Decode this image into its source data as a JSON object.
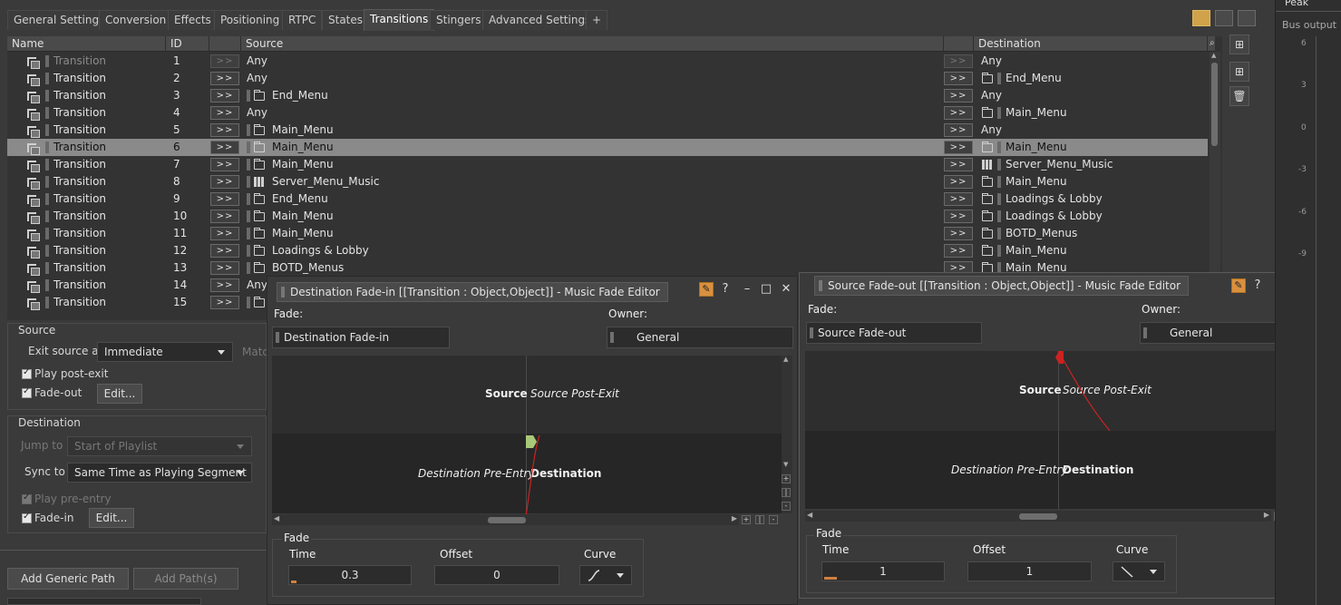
{
  "tabs": {
    "items": [
      "General Settings",
      "Conversion",
      "Effects",
      "Positioning",
      "RTPC",
      "States",
      "Transitions",
      "Stingers",
      "Advanced Settings",
      "+"
    ],
    "active": "Transitions"
  },
  "grid": {
    "headers": {
      "name": "Name",
      "id": "ID",
      "source": "Source",
      "destination": "Destination"
    },
    "arrow_label": ">>",
    "rows": [
      {
        "name": "Transition",
        "id": "1",
        "source": "Any",
        "source_icon": "none",
        "dest": "Any",
        "dest_icon": "none",
        "dim": true
      },
      {
        "name": "Transition",
        "id": "2",
        "source": "Any",
        "source_icon": "none",
        "dest": "End_Menu",
        "dest_icon": "folder"
      },
      {
        "name": "Transition",
        "id": "3",
        "source": "End_Menu",
        "source_icon": "folder",
        "dest": "Any",
        "dest_icon": "none"
      },
      {
        "name": "Transition",
        "id": "4",
        "source": "Any",
        "source_icon": "none",
        "dest": "Main_Menu",
        "dest_icon": "folder"
      },
      {
        "name": "Transition",
        "id": "5",
        "source": "Main_Menu",
        "source_icon": "folder",
        "dest": "Any",
        "dest_icon": "none"
      },
      {
        "name": "Transition",
        "id": "6",
        "source": "Main_Menu",
        "source_icon": "folder",
        "dest": "Main_Menu",
        "dest_icon": "folder",
        "selected": true
      },
      {
        "name": "Transition",
        "id": "7",
        "source": "Main_Menu",
        "source_icon": "folder",
        "dest": "Server_Menu_Music",
        "dest_icon": "grid"
      },
      {
        "name": "Transition",
        "id": "8",
        "source": "Server_Menu_Music",
        "source_icon": "grid",
        "dest": "Main_Menu",
        "dest_icon": "folder"
      },
      {
        "name": "Transition",
        "id": "9",
        "source": "End_Menu",
        "source_icon": "folder",
        "dest": "Loadings & Lobby",
        "dest_icon": "folder"
      },
      {
        "name": "Transition",
        "id": "10",
        "source": "Main_Menu",
        "source_icon": "folder",
        "dest": "Loadings & Lobby",
        "dest_icon": "folder"
      },
      {
        "name": "Transition",
        "id": "11",
        "source": "Main_Menu",
        "source_icon": "folder",
        "dest": "BOTD_Menus",
        "dest_icon": "folder"
      },
      {
        "name": "Transition",
        "id": "12",
        "source": "Loadings & Lobby",
        "source_icon": "folder",
        "dest": "Main_Menu",
        "dest_icon": "folder"
      },
      {
        "name": "Transition",
        "id": "13",
        "source": "BOTD_Menus",
        "source_icon": "folder",
        "dest": "Main_Menu",
        "dest_icon": "folder"
      },
      {
        "name": "Transition",
        "id": "14",
        "source": "Any",
        "source_icon": "none",
        "dest": "",
        "dest_icon": "none"
      },
      {
        "name": "Transition",
        "id": "15",
        "source": "",
        "source_icon": "folder",
        "dest": "",
        "dest_icon": "none"
      }
    ]
  },
  "source_panel": {
    "title": "Source",
    "exit_source_label": "Exit source at",
    "exit_source_value": "Immediate",
    "match_label": "Matc",
    "play_post_exit": "Play post-exit",
    "fade_out": "Fade-out",
    "edit": "Edit..."
  },
  "dest_panel": {
    "title": "Destination",
    "jump_to_label": "Jump to",
    "jump_to_value": "Start of Playlist",
    "sync_to_label": "Sync to",
    "sync_to_value": "Same Time as Playing Segment",
    "play_pre_entry": "Play pre-entry",
    "fade_in": "Fade-in",
    "edit": "Edit..."
  },
  "bottom_buttons": {
    "add_generic_path": "Add Generic Path",
    "add_paths": "Add Path(s)"
  },
  "fadein_editor": {
    "title": "Destination Fade-in [[Transition : Object,Object]] - Music Fade Editor",
    "fade_label": "Fade:",
    "fade_value": "Destination Fade-in",
    "owner_label": "Owner:",
    "owner_value": "General",
    "source_label": "Source",
    "source_post_exit": "Source Post-Exit",
    "dest_pre_entry": "Destination Pre-Entry",
    "destination_label": "Destination",
    "fade_group": "Fade",
    "time_label": "Time",
    "time_value": "0.3",
    "offset_label": "Offset",
    "offset_value": "0",
    "curve_label": "Curve"
  },
  "fadeout_editor": {
    "title": "Source Fade-out [[Transition : Object,Object]] - Music Fade Editor",
    "fade_label": "Fade:",
    "fade_value": "Source Fade-out",
    "owner_label": "Owner:",
    "owner_value": "General",
    "source_label": "Source",
    "source_post_exit": "Source Post-Exit",
    "dest_pre_entry": "Destination Pre-Entry",
    "destination_label": "Destination",
    "fade_group": "Fade",
    "time_label": "Time",
    "time_value": "1",
    "offset_label": "Offset",
    "offset_value": "1",
    "curve_label": "Curve"
  },
  "meter": {
    "peak_label": "Peak",
    "bus_output_label": "Bus output",
    "ticks": [
      "6",
      "3",
      "0",
      "-3",
      "-6",
      "-9"
    ]
  },
  "colors": {
    "accent_orange": "#d89040",
    "fade_in_marker": "#a8c878",
    "fade_out_marker": "#cc2222",
    "curve_red": "#cc2222"
  }
}
